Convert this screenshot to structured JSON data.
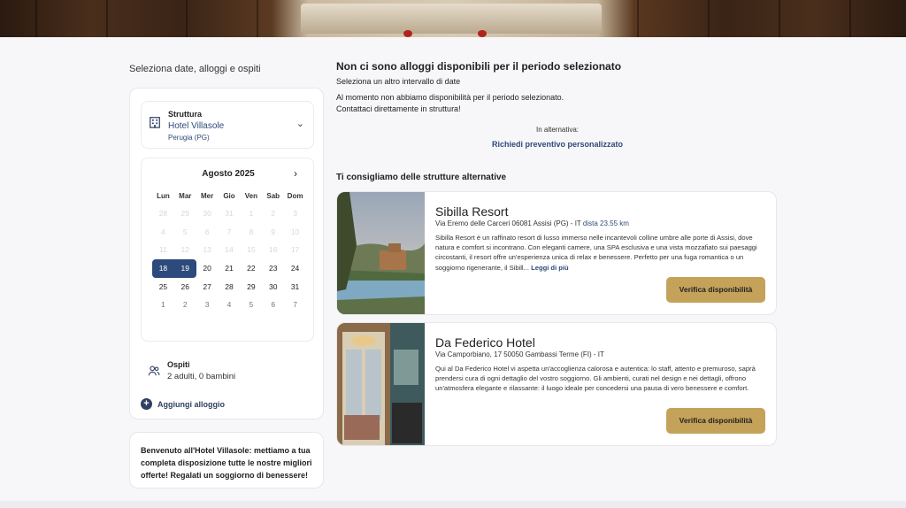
{
  "sidebar": {
    "title": "Seleziona date, alloggi e ospiti",
    "structure": {
      "label": "Struttura",
      "name": "Hotel Villasole",
      "city": "Perugia (PG)"
    },
    "calendar": {
      "month": "Agosto 2025",
      "weekdays": [
        "Lun",
        "Mar",
        "Mer",
        "Gio",
        "Ven",
        "Sab",
        "Dom"
      ],
      "days": [
        [
          "28",
          "29",
          "30",
          "31",
          "1",
          "2",
          "3"
        ],
        [
          "4",
          "5",
          "6",
          "7",
          "8",
          "9",
          "10"
        ],
        [
          "11",
          "12",
          "13",
          "14",
          "15",
          "16",
          "17"
        ],
        [
          "18",
          "19",
          "20",
          "21",
          "22",
          "23",
          "24"
        ],
        [
          "25",
          "26",
          "27",
          "28",
          "29",
          "30",
          "31"
        ],
        [
          "1",
          "2",
          "3",
          "4",
          "5",
          "6",
          "7"
        ]
      ],
      "selected": [
        "18",
        "19"
      ]
    },
    "guests": {
      "label": "Ospiti",
      "value": "2 adulti, 0 bambini"
    },
    "add_stay": "Aggiungi alloggio",
    "welcome": "Benvenuto all'Hotel Villasole: mettiamo a tua completa disposizione tutte le nostre migliori offerte! Regalati un soggiorno di benessere!"
  },
  "main": {
    "title": "Non ci sono alloggi disponibili per il periodo selezionato",
    "subtitle": "Seleziona un altro intervallo di date",
    "message_line1": "Al momento non abbiamo disponibilità per il periodo selezionato.",
    "message_line2": "Contattaci direttamente in struttura!",
    "alternative_label": "In alternativa:",
    "alternative_link": "Richiedi preventivo personalizzato",
    "suggest_title": "Ti consigliamo delle strutture alternative",
    "hotels": [
      {
        "name": "Sibilla Resort",
        "address": "Via Eremo delle Carceri 06081 Assisi (PG) - IT",
        "distance": "dista 23.55 km",
        "description": "Sibilla Resort è un raffinato resort di lusso immerso nelle incantevoli colline umbre alle porte di Assisi, dove natura e comfort si incontrano. Con eleganti camere, una SPA esclusiva e una vista mozzafiato sui paesaggi circostanti, il resort offre un'esperienza unica di relax e benessere. Perfetto per una fuga romantica o un soggiorno rigenerante, il Sibill...",
        "more": "Leggi di più",
        "button": "Verifica disponibilità"
      },
      {
        "name": "Da Federico Hotel",
        "address": "Via Camporbiano, 17 50050 Gambassi Terme (FI) - IT",
        "distance": "",
        "description": "Qui al Da Federico Hotel vi aspetta un'accoglienza calorosa e autentica: lo staff, attento e premuroso, saprà prendersi cura di ogni dettaglio del vostro soggiorno. Gli ambienti, curati nel design e nei dettagli, offrono un'atmosfera elegante e rilassante: il luogo ideale per concedersi una pausa di vero benessere e comfort.",
        "more": "",
        "button": "Verifica disponibilità"
      }
    ]
  },
  "colors": {
    "primary": "#2c4a7c",
    "accent": "#c4a25a"
  },
  "icons": {
    "structure": "building-icon",
    "guests": "users-icon",
    "add": "plus-circle-icon",
    "chevron": "chevron-down-icon",
    "next": "chevron-right-icon"
  }
}
